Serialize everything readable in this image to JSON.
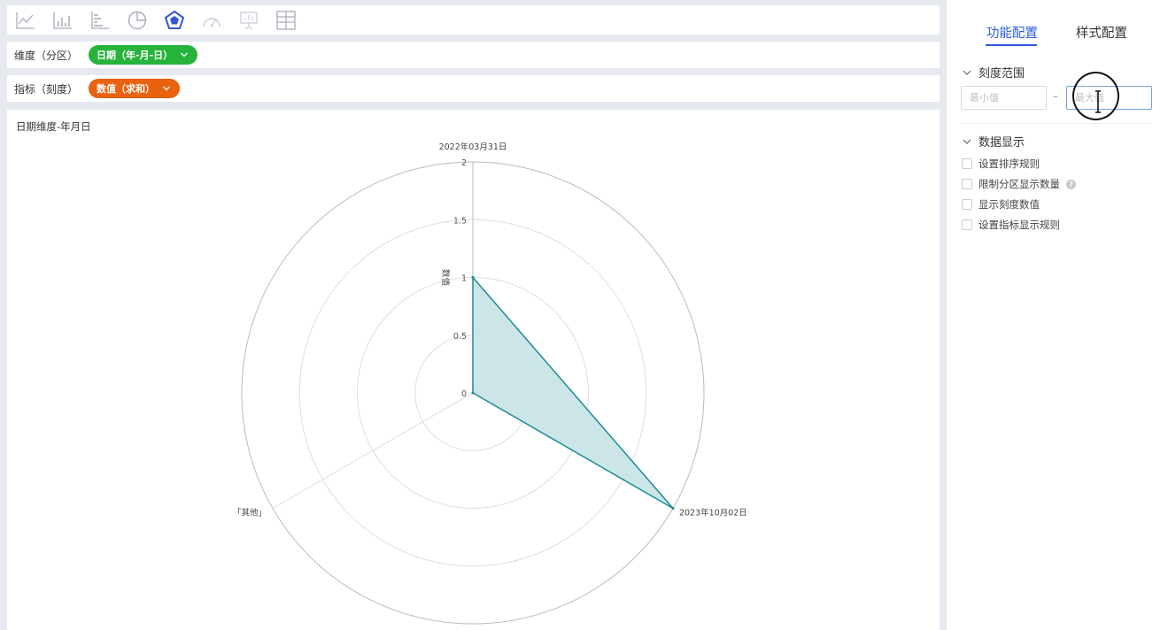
{
  "toolbar": {
    "chart_types": [
      {
        "icon": "line-chart-icon",
        "active": false
      },
      {
        "icon": "bar-chart-icon",
        "active": false
      },
      {
        "icon": "horizontal-bar-chart-icon",
        "active": false
      },
      {
        "icon": "pie-chart-icon",
        "active": false
      },
      {
        "icon": "radar-chart-icon",
        "active": true
      },
      {
        "icon": "gauge-chart-icon",
        "active": false
      },
      {
        "icon": "presentation-chart-icon",
        "active": false
      },
      {
        "icon": "table-grid-icon",
        "active": false
      }
    ]
  },
  "dimension": {
    "label": "维度（分区）",
    "pill": "日期（年-月-日）",
    "color": "#27b33a"
  },
  "metric": {
    "label": "指标（刻度）",
    "pill": "数值（求和）",
    "color": "#e8620f"
  },
  "chart_title": "日期维度-年月日",
  "chart_data": {
    "type": "radar",
    "indicators": [
      "2022年03月31日",
      "2023年10月02日",
      "「其他」"
    ],
    "series": [
      {
        "values": [
          1,
          2,
          0
        ]
      }
    ],
    "radial_axis": {
      "label": "数值",
      "ticks": [
        "0",
        "0.5",
        "1",
        "1.5",
        "2"
      ],
      "range": [
        0,
        2
      ]
    },
    "fill_color": "#c7e3e6",
    "line_color": "#1b8a96"
  },
  "sidebar": {
    "tabs": [
      "功能配置",
      "样式配置"
    ],
    "active_tab": "功能配置",
    "scale_range": {
      "title": "刻度范围",
      "min_placeholder": "最小值",
      "max_placeholder": "最大值",
      "separator": "–"
    },
    "data_display": {
      "title": "数据显示",
      "options": [
        "设置排序规则",
        "限制分区显示数量",
        "显示刻度数值",
        "设置指标显示规则"
      ]
    }
  }
}
